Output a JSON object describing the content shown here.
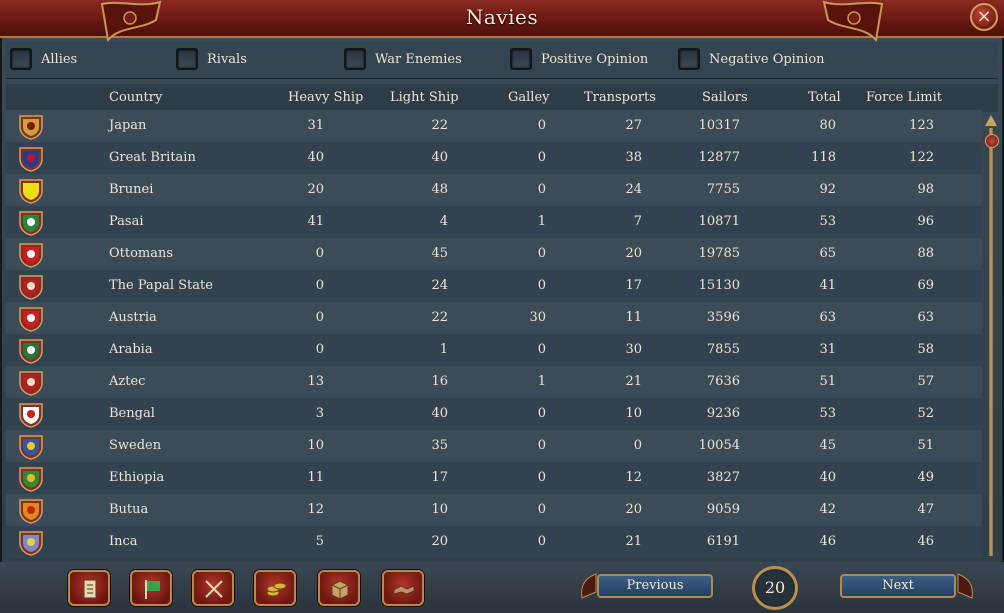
{
  "window": {
    "title": "Navies",
    "close_label": "×"
  },
  "filters": [
    {
      "label": "Allies"
    },
    {
      "label": "Rivals"
    },
    {
      "label": "War Enemies"
    },
    {
      "label": "Positive Opinion"
    },
    {
      "label": "Negative Opinion"
    }
  ],
  "columns": {
    "country": "Country",
    "heavy": "Heavy Ship",
    "light": "Light Ship",
    "galley": "Galley",
    "transports": "Transports",
    "sailors": "Sailors",
    "total": "Total",
    "force_limit": "Force Limit"
  },
  "rows": [
    {
      "country": "Japan",
      "heavy": "31",
      "light": "22",
      "galley": "0",
      "transports": "27",
      "sailors": "10317",
      "total": "80",
      "force_limit": "123",
      "flag": "japan-flag-icon",
      "colors": [
        "#c9a23a",
        "#7a1a12"
      ]
    },
    {
      "country": "Great Britain",
      "heavy": "40",
      "light": "40",
      "galley": "0",
      "transports": "38",
      "sailors": "12877",
      "total": "118",
      "force_limit": "122",
      "flag": "great-britain-flag-icon",
      "colors": [
        "#1f3e8c",
        "#c8102e"
      ]
    },
    {
      "country": "Brunei",
      "heavy": "20",
      "light": "48",
      "galley": "0",
      "transports": "24",
      "sailors": "7755",
      "total": "92",
      "force_limit": "98",
      "flag": "brunei-flag-icon",
      "colors": [
        "#e6e014",
        "#e6e014"
      ]
    },
    {
      "country": "Pasai",
      "heavy": "41",
      "light": "4",
      "galley": "1",
      "transports": "7",
      "sailors": "10871",
      "total": "53",
      "force_limit": "96",
      "flag": "pasai-flag-icon",
      "colors": [
        "#1e8a3a",
        "#ffffff"
      ]
    },
    {
      "country": "Ottomans",
      "heavy": "0",
      "light": "45",
      "galley": "0",
      "transports": "20",
      "sailors": "19785",
      "total": "65",
      "force_limit": "88",
      "flag": "ottomans-flag-icon",
      "colors": [
        "#c8201c",
        "#ffffff"
      ]
    },
    {
      "country": "The Papal State",
      "heavy": "0",
      "light": "24",
      "galley": "0",
      "transports": "17",
      "sailors": "15130",
      "total": "41",
      "force_limit": "69",
      "flag": "papal-state-flag-icon",
      "colors": [
        "#b02020",
        "#e8e0c0"
      ]
    },
    {
      "country": "Austria",
      "heavy": "0",
      "light": "22",
      "galley": "30",
      "transports": "11",
      "sailors": "3596",
      "total": "63",
      "force_limit": "63",
      "flag": "austria-flag-icon",
      "colors": [
        "#c8201c",
        "#ffffff"
      ]
    },
    {
      "country": "Arabia",
      "heavy": "0",
      "light": "1",
      "galley": "0",
      "transports": "30",
      "sailors": "7855",
      "total": "31",
      "force_limit": "58",
      "flag": "arabia-flag-icon",
      "colors": [
        "#1e7a3a",
        "#ffffff"
      ]
    },
    {
      "country": "Aztec",
      "heavy": "13",
      "light": "16",
      "galley": "1",
      "transports": "21",
      "sailors": "7636",
      "total": "51",
      "force_limit": "57",
      "flag": "aztec-flag-icon",
      "colors": [
        "#b02020",
        "#e8e0c0"
      ]
    },
    {
      "country": "Bengal",
      "heavy": "3",
      "light": "40",
      "galley": "0",
      "transports": "10",
      "sailors": "9236",
      "total": "53",
      "force_limit": "52",
      "flag": "bengal-flag-icon",
      "colors": [
        "#ffffff",
        "#c8201c"
      ]
    },
    {
      "country": "Sweden",
      "heavy": "10",
      "light": "35",
      "galley": "0",
      "transports": "0",
      "sailors": "10054",
      "total": "45",
      "force_limit": "51",
      "flag": "sweden-flag-icon",
      "colors": [
        "#2a5aa8",
        "#f2c81c"
      ]
    },
    {
      "country": "Ethiopia",
      "heavy": "11",
      "light": "17",
      "galley": "0",
      "transports": "12",
      "sailors": "3827",
      "total": "40",
      "force_limit": "49",
      "flag": "ethiopia-flag-icon",
      "colors": [
        "#2a8a3a",
        "#e0c020"
      ]
    },
    {
      "country": "Butua",
      "heavy": "12",
      "light": "10",
      "galley": "0",
      "transports": "20",
      "sailors": "9059",
      "total": "42",
      "force_limit": "47",
      "flag": "butua-flag-icon",
      "colors": [
        "#e08a1c",
        "#c8201c"
      ]
    },
    {
      "country": "Inca",
      "heavy": "5",
      "light": "20",
      "galley": "0",
      "transports": "21",
      "sailors": "6191",
      "total": "46",
      "force_limit": "46",
      "flag": "inca-flag-icon",
      "colors": [
        "#7a8ad0",
        "#e8d040"
      ]
    }
  ],
  "pagination": {
    "previous_label": "Previous",
    "next_label": "Next",
    "page": "20"
  },
  "bottom_tabs": [
    {
      "name": "ledger-tab-button",
      "icon": "scroll-icon"
    },
    {
      "name": "flag-tab-button",
      "icon": "flag-icon"
    },
    {
      "name": "armies-tab-button",
      "icon": "crossed-swords-icon"
    },
    {
      "name": "economy-tab-button",
      "icon": "coins-icon"
    },
    {
      "name": "production-tab-button",
      "icon": "crate-icon"
    },
    {
      "name": "diplomacy-tab-button",
      "icon": "handshake-icon"
    }
  ]
}
